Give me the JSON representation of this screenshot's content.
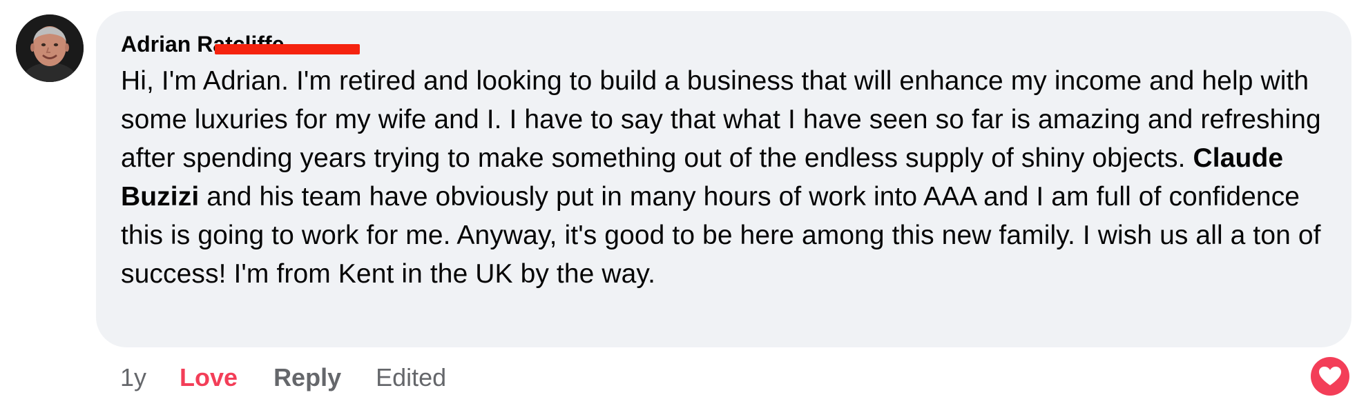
{
  "comment": {
    "author": "Adrian Ratcliffe",
    "body_parts": {
      "before_mention": "Hi, I'm Adrian. I'm retired and looking to build a business that will enhance my income and help with some luxuries for my wife and I. I have to say that what I have seen so far is amazing and refreshing after spending years trying to make something out of the endless supply of shiny objects. ",
      "mention": "Claude Buzizi",
      "after_mention": " and his team have obviously put in many hours of work into AAA and I am full of confidence this is going to work for me. Anyway, it's good to be here among this new family. I wish us all a ton of success! I'm from Kent in the UK by the way."
    },
    "reaction": {
      "type": "heart-icon",
      "color": "#f33e58"
    }
  },
  "actions": {
    "time": "1y",
    "love_label": "Love",
    "reply_label": "Reply",
    "edited_label": "Edited"
  },
  "colors": {
    "bubble_bg": "#f0f2f5",
    "love_accent": "#f33e58",
    "muted_text": "#65676b",
    "redaction": "#f5230f"
  }
}
